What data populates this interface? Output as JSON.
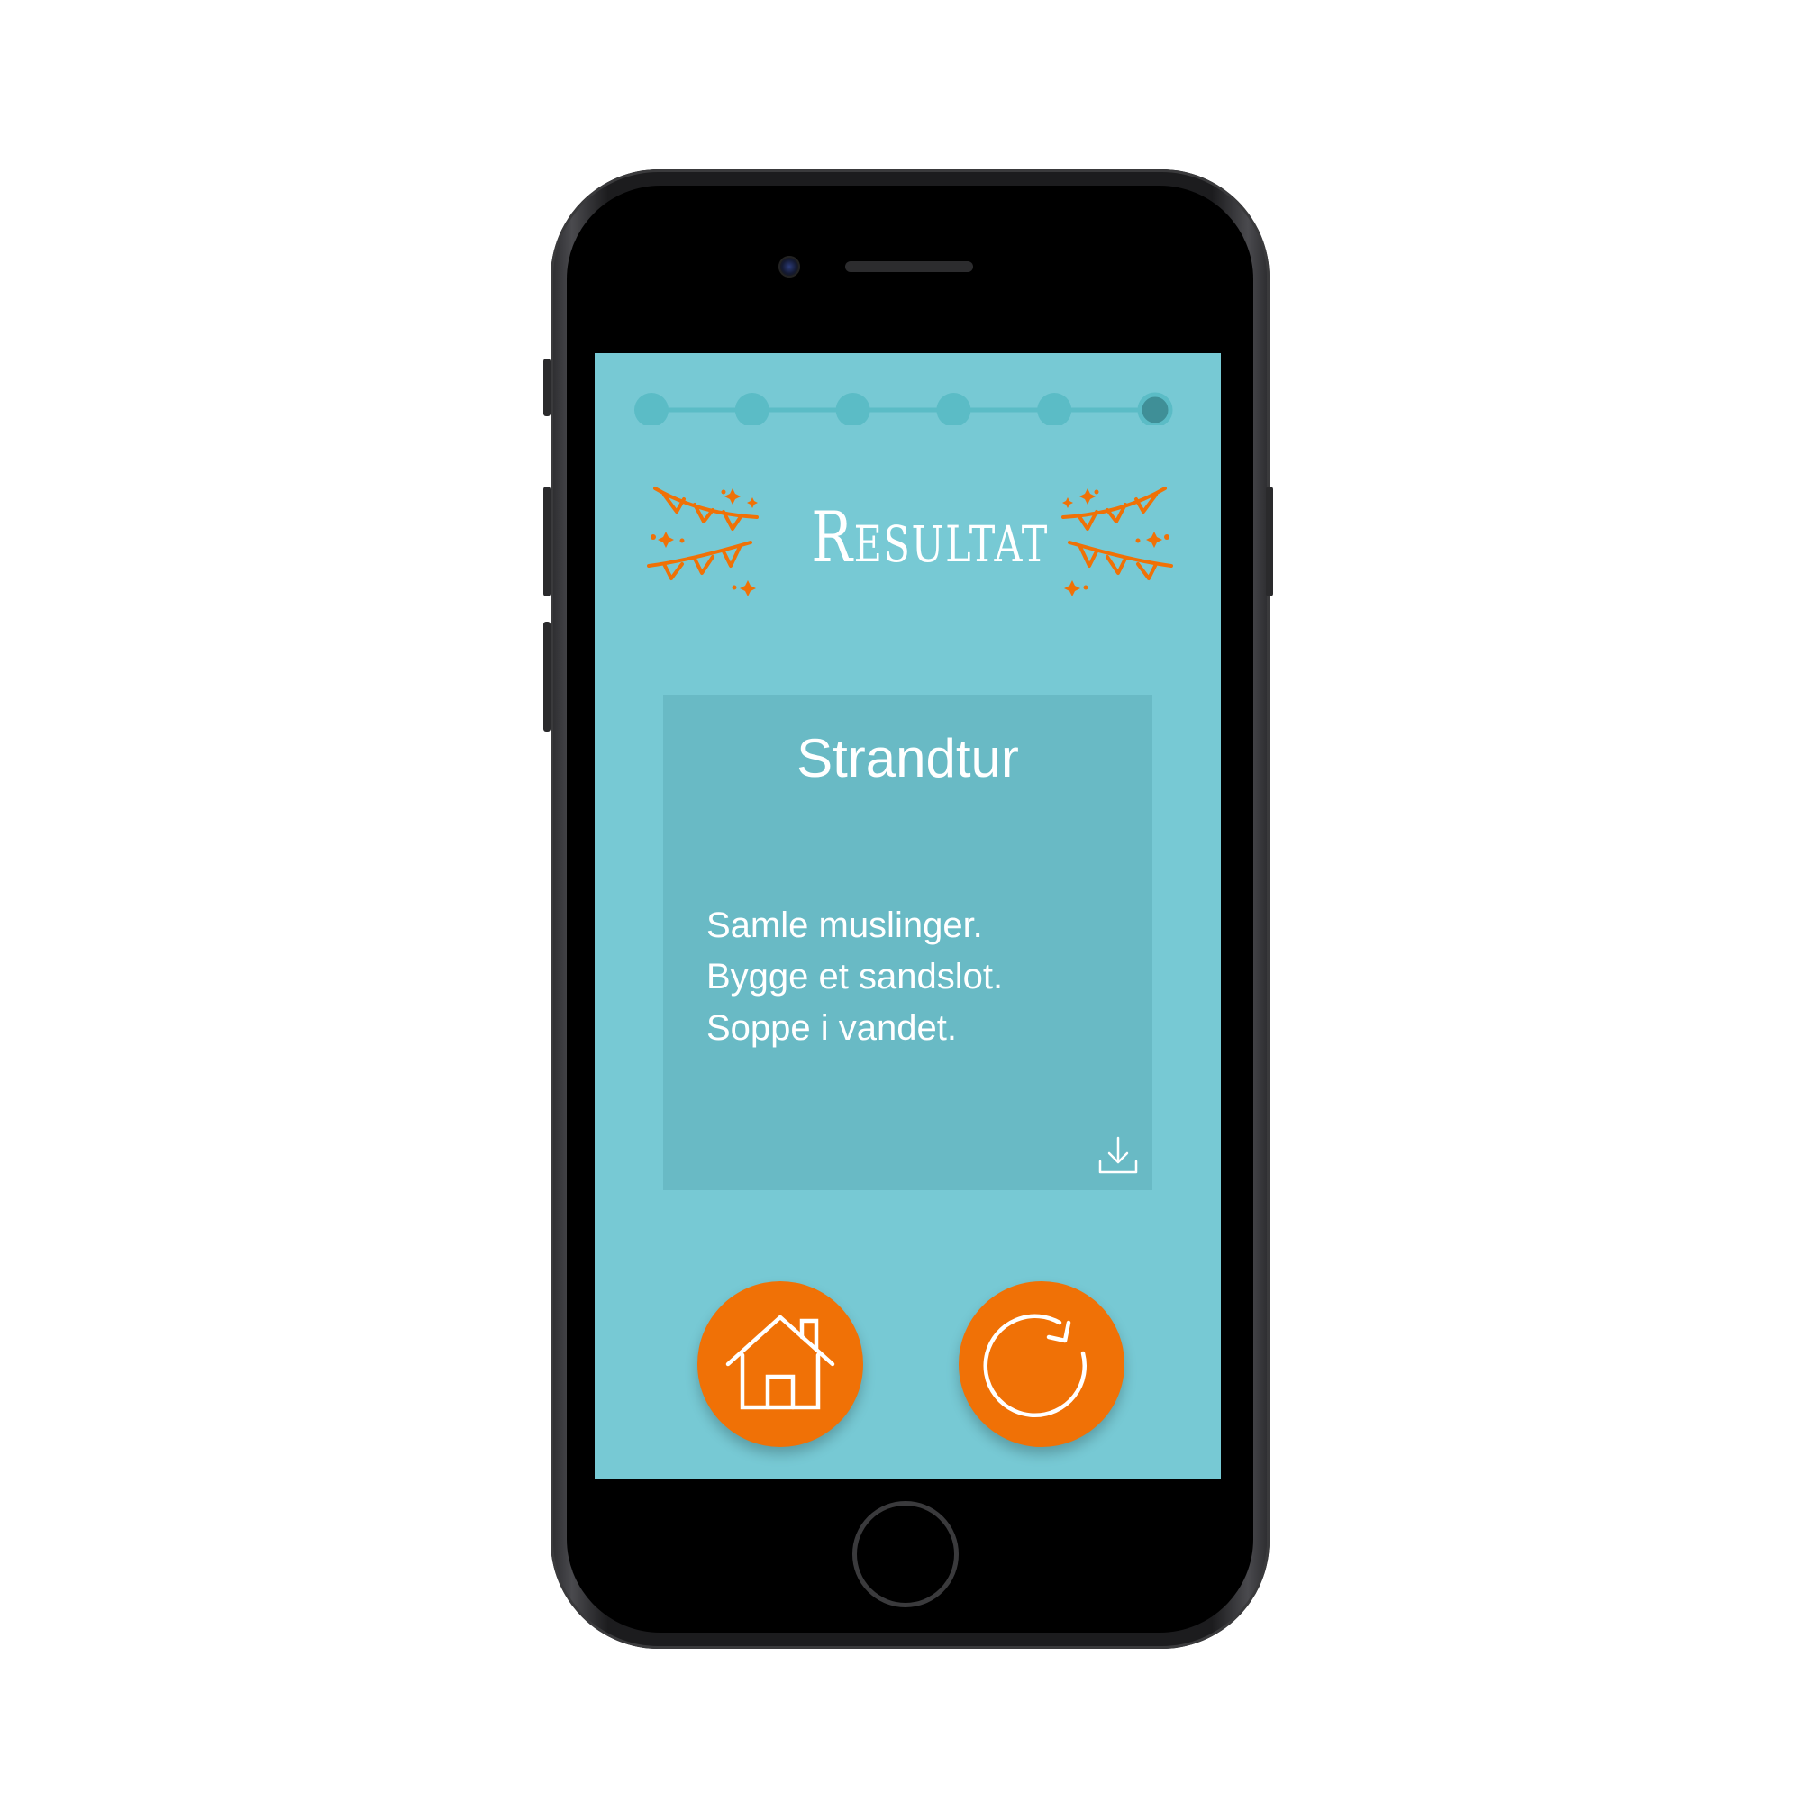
{
  "app": {
    "title": "Resultat",
    "progress": {
      "total_steps": 6,
      "current_step": 6
    }
  },
  "result_card": {
    "title": "Strandtur",
    "activities": [
      "Samle muslinger.",
      "Bygge et sandslot.",
      "Soppe i vandet."
    ],
    "download_icon": "download-icon"
  },
  "actions": {
    "home_icon": "home-icon",
    "restart_icon": "refresh-icon"
  },
  "colors": {
    "screen_background": "#77c9d4",
    "card_background": "#69bac5",
    "progress_dot": "#5bbcc6",
    "progress_dot_active": "#3f8f97",
    "accent_orange": "#f07106",
    "text": "#ffffff"
  }
}
